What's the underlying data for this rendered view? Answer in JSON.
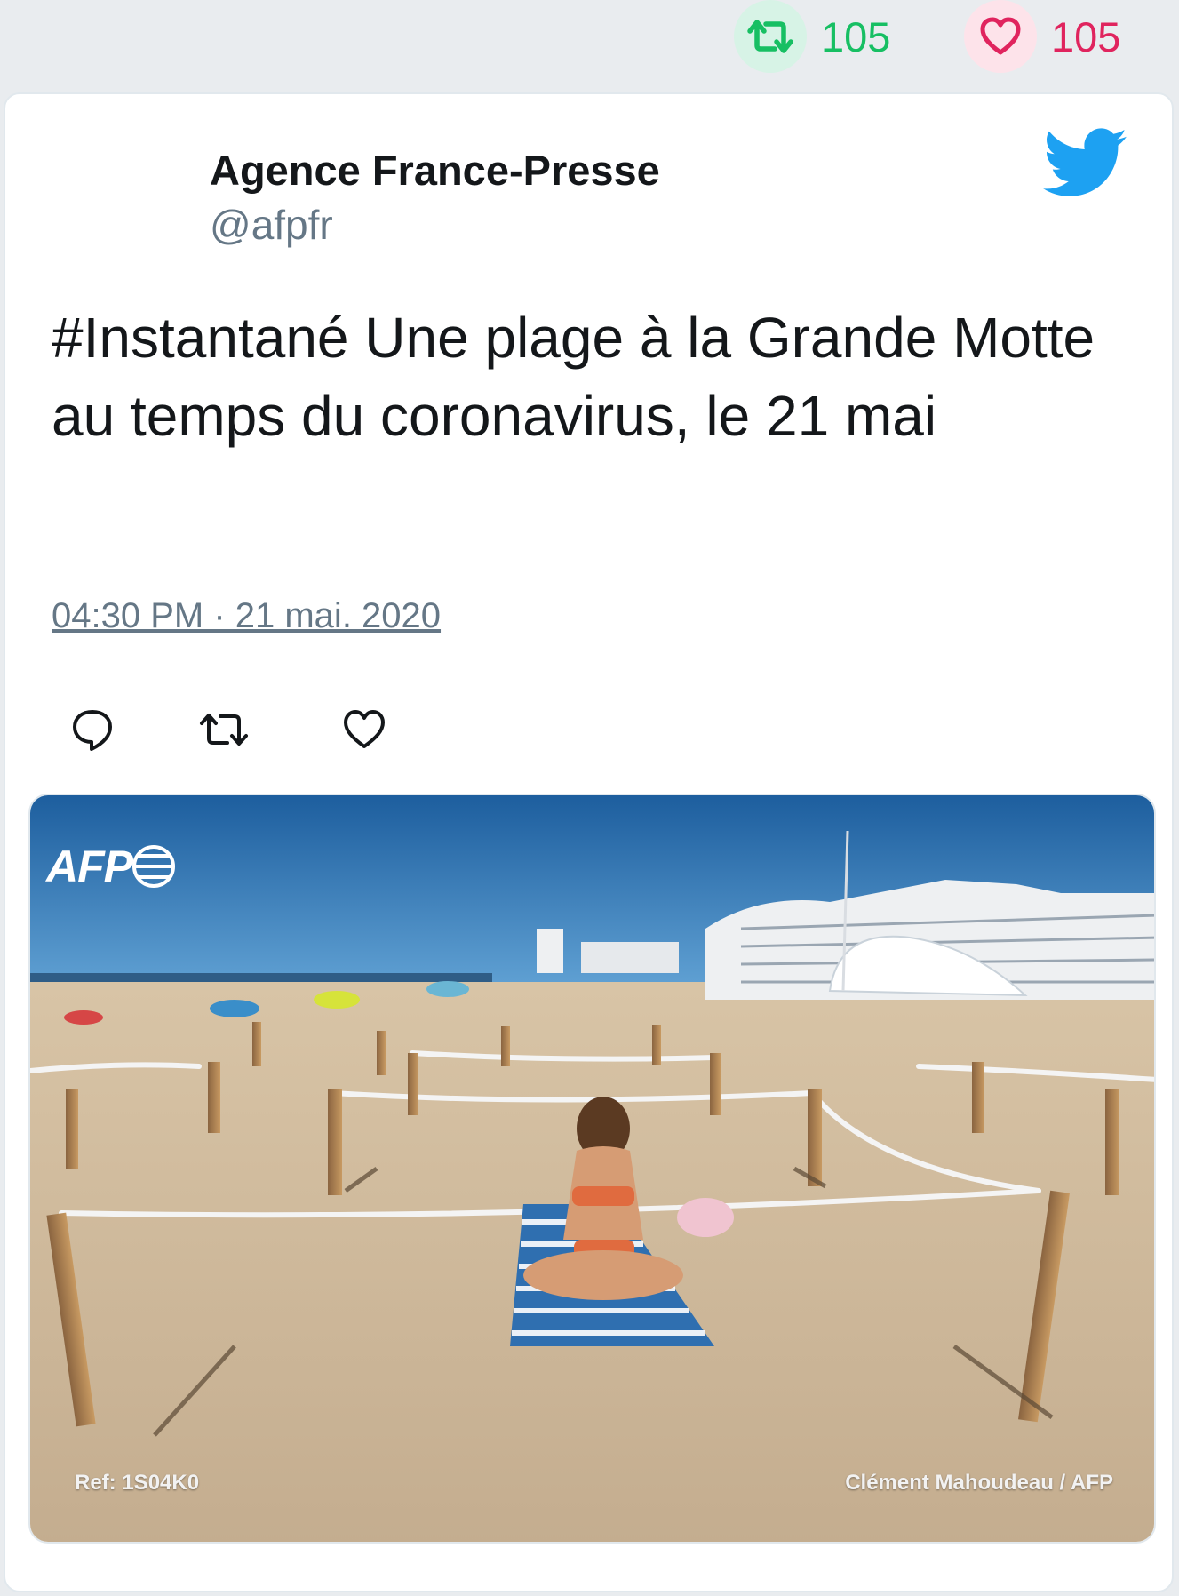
{
  "top_stats": {
    "retweet_count": "105",
    "like_count": "105",
    "retweet_color": "#17bf63",
    "like_color": "#e0245e"
  },
  "tweet": {
    "author_name": "Agence France-Presse",
    "author_handle": "@afpfr",
    "text": "#Instantané Une plage à la Grande Motte au temps du coronavirus, le 21 mai",
    "timestamp": "04:30 PM · 21 mai. 2020",
    "icons": [
      "twitter-bird-icon",
      "reply-icon",
      "retweet-icon",
      "like-icon"
    ],
    "accent_color": "#1da1f2"
  },
  "media": {
    "logo_text": "AFP",
    "ref_text": "Ref: 1S04K0",
    "credit_text": "Clément Mahoudeau / AFP"
  }
}
